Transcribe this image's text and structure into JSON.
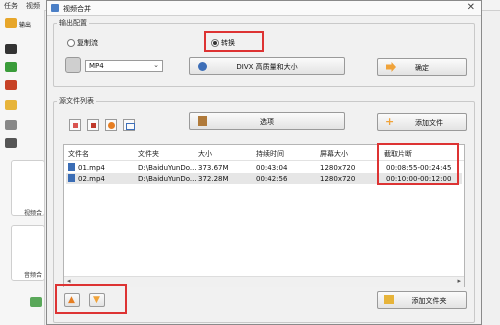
{
  "background": {
    "menu": [
      "任务",
      "视频"
    ],
    "left_label_top": "输出",
    "card_labels": [
      "视频合",
      "音频合"
    ]
  },
  "dialog": {
    "title": "视频合并",
    "output_settings": {
      "group_label": "输出配置",
      "radio_copy": "复制流",
      "radio_convert": "转换",
      "format_value": "MP4",
      "quality_button": "DIVX 高质量和大小",
      "ok_button": "确定"
    },
    "source_list": {
      "group_label": "源文件列表",
      "options_button": "选项",
      "add_file_button": "添加文件",
      "columns": [
        "文件名",
        "文件夹",
        "大小",
        "持续时间",
        "屏幕大小",
        "截取片断"
      ],
      "rows": [
        [
          "01.mp4",
          "D:\\BaiduYunDo...",
          "373.67M",
          "00:43:04",
          "1280x720",
          "00:08:55-00:24:45"
        ],
        [
          "02.mp4",
          "D:\\BaiduYunDo...",
          "372.28M",
          "00:42:56",
          "1280x720",
          "00:10:00-00:12:00"
        ]
      ]
    },
    "add_folder_button": "添加文件夹"
  },
  "colors": {
    "highlight": "#d33333",
    "accent": "#4b7fc6"
  }
}
